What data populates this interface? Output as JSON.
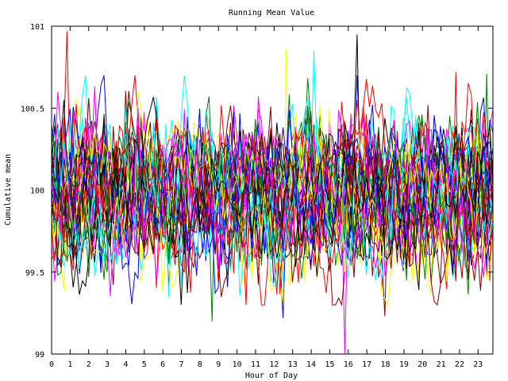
{
  "chart_data": {
    "type": "line",
    "title": "Running Mean Value",
    "xlabel": "Hour of Day",
    "ylabel": "Cumulative mean",
    "xlim": [
      0,
      23.8
    ],
    "ylim": [
      99,
      101
    ],
    "x_ticks": [
      0,
      1,
      2,
      3,
      4,
      5,
      6,
      7,
      8,
      9,
      10,
      11,
      12,
      13,
      14,
      15,
      16,
      17,
      18,
      19,
      20,
      21,
      22,
      23
    ],
    "x_tick_labels": [
      "0",
      "1",
      "2",
      "3",
      "4",
      "5",
      "6",
      "7",
      "8",
      "9",
      "10",
      "11",
      "12",
      "13",
      "14",
      "15",
      "16",
      "17",
      "18",
      "19",
      "20",
      "21",
      "22",
      "23"
    ],
    "y_ticks": [
      99,
      99.5,
      100,
      100.5,
      101
    ],
    "y_tick_labels": [
      "99",
      "99.5",
      "100",
      "100.5",
      "101"
    ],
    "grid": false,
    "legend": "none",
    "series_colors": [
      "#ff0000",
      "#008000",
      "#0000ff",
      "#ffff00",
      "#00ffff",
      "#ff00ff",
      "#000000",
      "#800000"
    ],
    "series_count": 40,
    "points_per_series": 144,
    "center_value": 100,
    "typical_range": [
      99.6,
      100.45
    ],
    "notable_extremes": [
      {
        "x": 0.8,
        "y": 100.97
      },
      {
        "x": 8.6,
        "y": 99.2
      },
      {
        "x": 12.4,
        "y": 99.22
      },
      {
        "x": 12.7,
        "y": 100.86
      },
      {
        "x": 14.1,
        "y": 100.85
      },
      {
        "x": 15.75,
        "y": 99.0
      },
      {
        "x": 16.5,
        "y": 100.95
      },
      {
        "x": 18.0,
        "y": 99.23
      },
      {
        "x": 21.8,
        "y": 100.72
      },
      {
        "x": 23.5,
        "y": 100.71
      }
    ]
  }
}
